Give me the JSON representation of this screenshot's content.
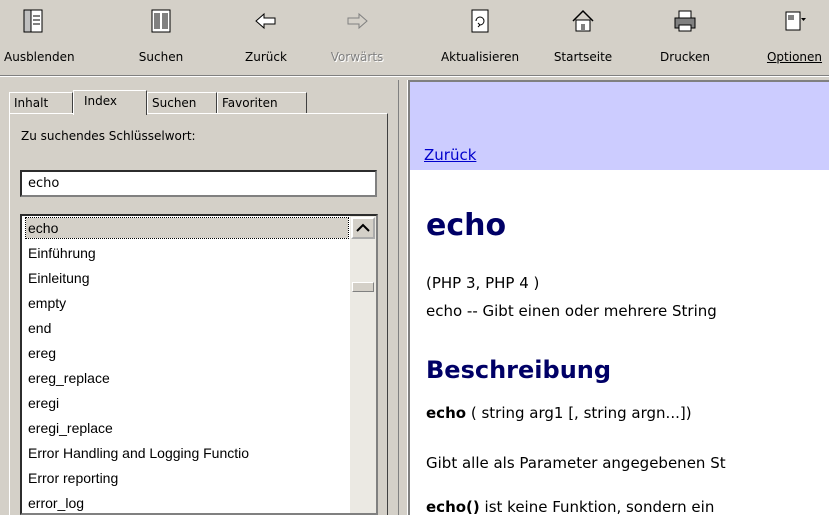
{
  "toolbar": {
    "buttons": [
      {
        "label": "Ausblenden",
        "icon": "hide-pane-icon"
      },
      {
        "label": "Suchen",
        "icon": "search-icon"
      },
      {
        "label": "Zurück",
        "icon": "back-arrow-icon"
      },
      {
        "label": "Vorwärts",
        "icon": "forward-arrow-icon",
        "disabled": true
      },
      {
        "label": "Aktualisieren",
        "icon": "refresh-icon"
      },
      {
        "label": "Startseite",
        "icon": "home-icon"
      },
      {
        "label": "Drucken",
        "icon": "print-icon"
      },
      {
        "label": "Optionen",
        "icon": "options-icon"
      }
    ]
  },
  "left": {
    "tabs": [
      "Inhalt",
      "Index",
      "Suchen",
      "Favoriten"
    ],
    "active_tab": "Index",
    "keyword_label": "Zu suchendes Schlüsselwort:",
    "keyword_value": "echo",
    "items": [
      "echo",
      "Einführung",
      "Einleitung",
      "empty",
      "end",
      "ereg",
      "ereg_replace",
      "eregi",
      "eregi_replace",
      "Error Handling and Logging Functio",
      "Error reporting",
      "error_log"
    ],
    "selected_index": 0
  },
  "right": {
    "back_link": "Zurück",
    "title": "echo",
    "versions": "(PHP 3, PHP 4 )",
    "summary": "echo -- Gibt einen oder mehrere String",
    "section": "Beschreibung",
    "signature_name": "echo",
    "signature_rest": " ( string arg1 [, string argn...])",
    "para1": "Gibt alle als Parameter angegebenen St",
    "para2_bold": "echo()",
    "para2_rest": " ist keine Funktion, sondern ein"
  },
  "colors": {
    "chrome": "#d4d0c8",
    "nav_bar": "#ccccff",
    "heading": "#000066",
    "link": "#0000cc"
  }
}
